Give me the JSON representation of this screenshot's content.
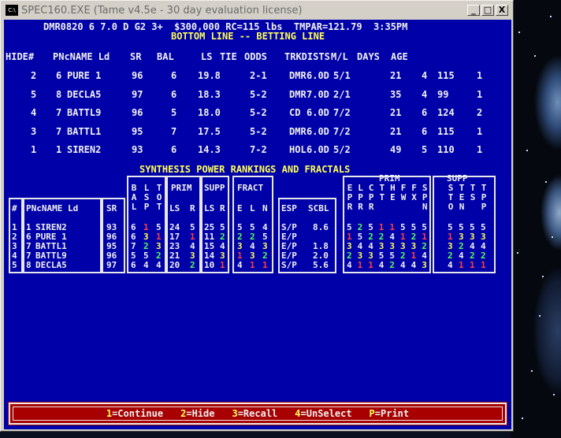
{
  "window": {
    "title": "SPEC160.EXE (Tame v4.5e - 30 day evaluation license)",
    "icon_text": "C:\\",
    "minimize": "_",
    "maximize": "□",
    "close": "X"
  },
  "header": {
    "race_line": "DMR0820 6 7.0 D G2 3+  $300,000 RC=115 lbs  TMPAR=121.79  3:35PM",
    "subtitle": "BOTTOM LINE -- BETTING LINE"
  },
  "betting_line": {
    "columns": [
      "HIDE#",
      "PNcNAME Ld",
      "SR",
      "BAL",
      "LS",
      "TIE",
      "ODDS",
      "TRKDISTS",
      "M/L",
      "DAYS",
      "AGE"
    ],
    "rows": [
      {
        "hide": "2",
        "pn": "6",
        "name": "PURE 1",
        "sr": "96",
        "bal": "6",
        "ls": "19.8",
        "odds": "2-1",
        "trk": "DMR",
        "dist": "6.0D",
        "ml": "5/1",
        "days": "21",
        "age": "4",
        "extra1": "115",
        "extra2": "1"
      },
      {
        "hide": "5",
        "pn": "8",
        "name": "DECLA5",
        "sr": "97",
        "bal": "6",
        "ls": "18.3",
        "odds": "5-2",
        "trk": "DMR",
        "dist": "7.0D",
        "ml": "2/1",
        "days": "35",
        "age": "4",
        "extra1": "99",
        "extra2": "1"
      },
      {
        "hide": "4",
        "pn": "7",
        "name": "BATTL9",
        "sr": "96",
        "bal": "5",
        "ls": "18.0",
        "odds": "5-2",
        "trk": "CD",
        "dist": "6.0D",
        "ml": "7/2",
        "days": "21",
        "age": "6",
        "extra1": "124",
        "extra2": "2"
      },
      {
        "hide": "3",
        "pn": "7",
        "name": "BATTL1",
        "sr": "95",
        "bal": "7",
        "ls": "17.5",
        "odds": "5-2",
        "trk": "DMR",
        "dist": "6.0D",
        "ml": "7/2",
        "days": "21",
        "age": "6",
        "extra1": "115",
        "extra2": "1"
      },
      {
        "hide": "1",
        "pn": "1",
        "name": "SIREN2",
        "sr": "93",
        "bal": "6",
        "ls": "14.3",
        "odds": "7-2",
        "trk": "HOL",
        "dist": "6.0D",
        "ml": "5/2",
        "days": "49",
        "age": "5",
        "extra1": "110",
        "extra2": "1"
      }
    ]
  },
  "synthesis": {
    "title": "SYNTHESIS POWER RANKINGS AND FRACTALS",
    "group_prim": "PRIM",
    "group_supp": "SUPP",
    "group_fract": "FRACT",
    "group_prim2": "PRIM",
    "group_supp2": "SUPP",
    "col_hash": "#",
    "col_name": "PNcNAME Ld",
    "col_sr": "SR",
    "col_bal": "BAL",
    "col_lsp": "LSP",
    "col_tot": "TOT",
    "col_prim_ls": "LS",
    "col_prim_r": "R",
    "col_supp_ls": "LS",
    "col_supp_r": "R",
    "col_e": "E",
    "col_l": "L",
    "col_n": "N",
    "col_esp": "ESP",
    "col_scbl": "SCBL",
    "right_cols": [
      "EPR",
      "LPR",
      "CPR",
      "TT",
      "HE",
      "FW",
      "FX",
      "SPN",
      "STO",
      "TEN",
      "TS",
      "TPP"
    ],
    "rows": [
      {
        "num": "1",
        "pn": "1",
        "name": "SIREN2",
        "sr": "93",
        "b": "6",
        "l": "1",
        "t": "5",
        "pls": "24",
        "pr": "5",
        "sls": "25",
        "sr2": "5",
        "e": "5",
        "fl": "5",
        "n": "4",
        "esp": "S/P",
        "scbl": "8.6",
        "rc": [
          "5",
          "2",
          "5",
          "1",
          "1",
          "5",
          "5",
          "5",
          "5",
          "5",
          "5",
          "5"
        ],
        "rcc": [
          "w",
          "g",
          "w",
          "r",
          "r",
          "w",
          "w",
          "w",
          "w",
          "w",
          "w",
          "w"
        ]
      },
      {
        "num": "2",
        "pn": "6",
        "name": "PURE 1",
        "sr": "96",
        "b": "6",
        "l": "3",
        "t": "1",
        "pls": "17",
        "pr": "1",
        "sls": "11",
        "sr2": "2",
        "e": "2",
        "fl": "2",
        "n": "5",
        "esp": "E/P",
        "scbl": "",
        "rc": [
          "1",
          "5",
          "2",
          "2",
          "4",
          "1",
          "2",
          "1",
          "1",
          "3",
          "3",
          "3"
        ],
        "rcc": [
          "r",
          "w",
          "g",
          "g",
          "w",
          "r",
          "g",
          "r",
          "r",
          "y",
          "y",
          "y"
        ]
      },
      {
        "num": "3",
        "pn": "7",
        "name": "BATTL1",
        "sr": "95",
        "b": "7",
        "l": "2",
        "t": "3",
        "pls": "23",
        "pr": "4",
        "sls": "15",
        "sr2": "4",
        "e": "3",
        "fl": "4",
        "n": "3",
        "esp": "E/P",
        "scbl": "1.8",
        "rc": [
          "3",
          "4",
          "4",
          "3",
          "3",
          "3",
          "3",
          "2",
          "3",
          "2",
          "4",
          "4"
        ],
        "rcc": [
          "y",
          "w",
          "w",
          "y",
          "y",
          "y",
          "y",
          "g",
          "y",
          "g",
          "w",
          "w"
        ]
      },
      {
        "num": "4",
        "pn": "7",
        "name": "BATTL9",
        "sr": "96",
        "b": "5",
        "l": "5",
        "t": "2",
        "pls": "21",
        "pr": "3",
        "sls": "14",
        "sr2": "3",
        "e": "1",
        "fl": "3",
        "n": "2",
        "esp": "E/P",
        "scbl": "2.0",
        "rc": [
          "2",
          "3",
          "3",
          "5",
          "5",
          "2",
          "1",
          "4",
          "2",
          "4",
          "2",
          "2"
        ],
        "rcc": [
          "g",
          "y",
          "y",
          "w",
          "w",
          "g",
          "r",
          "w",
          "g",
          "w",
          "g",
          "g"
        ]
      },
      {
        "num": "5",
        "pn": "8",
        "name": "DECLA5",
        "sr": "97",
        "b": "6",
        "l": "4",
        "t": "4",
        "pls": "20",
        "pr": "2",
        "sls": "10",
        "sr2": "1",
        "e": "4",
        "fl": "1",
        "n": "1",
        "esp": "S/P",
        "scbl": "5.6",
        "rc": [
          "4",
          "1",
          "1",
          "4",
          "2",
          "4",
          "4",
          "3",
          "4",
          "1",
          "1",
          "1"
        ],
        "rcc": [
          "w",
          "r",
          "r",
          "w",
          "g",
          "w",
          "w",
          "y",
          "w",
          "r",
          "r",
          "r"
        ]
      }
    ]
  },
  "footer": {
    "k1": "1",
    "l1": "=Continue",
    "k2": "2",
    "l2": "=Hide",
    "k3": "3",
    "l3": "=Recall",
    "k4": "4",
    "l4": "=UnSelect",
    "k5": "P",
    "l5": "=Print"
  },
  "colors": {
    "console_bg": "#0000a8",
    "header_text": "#ffff55",
    "footer_bg": "#a80000",
    "rank1": "#ff4040",
    "rank2": "#55ff55",
    "rank3": "#ffff55"
  }
}
